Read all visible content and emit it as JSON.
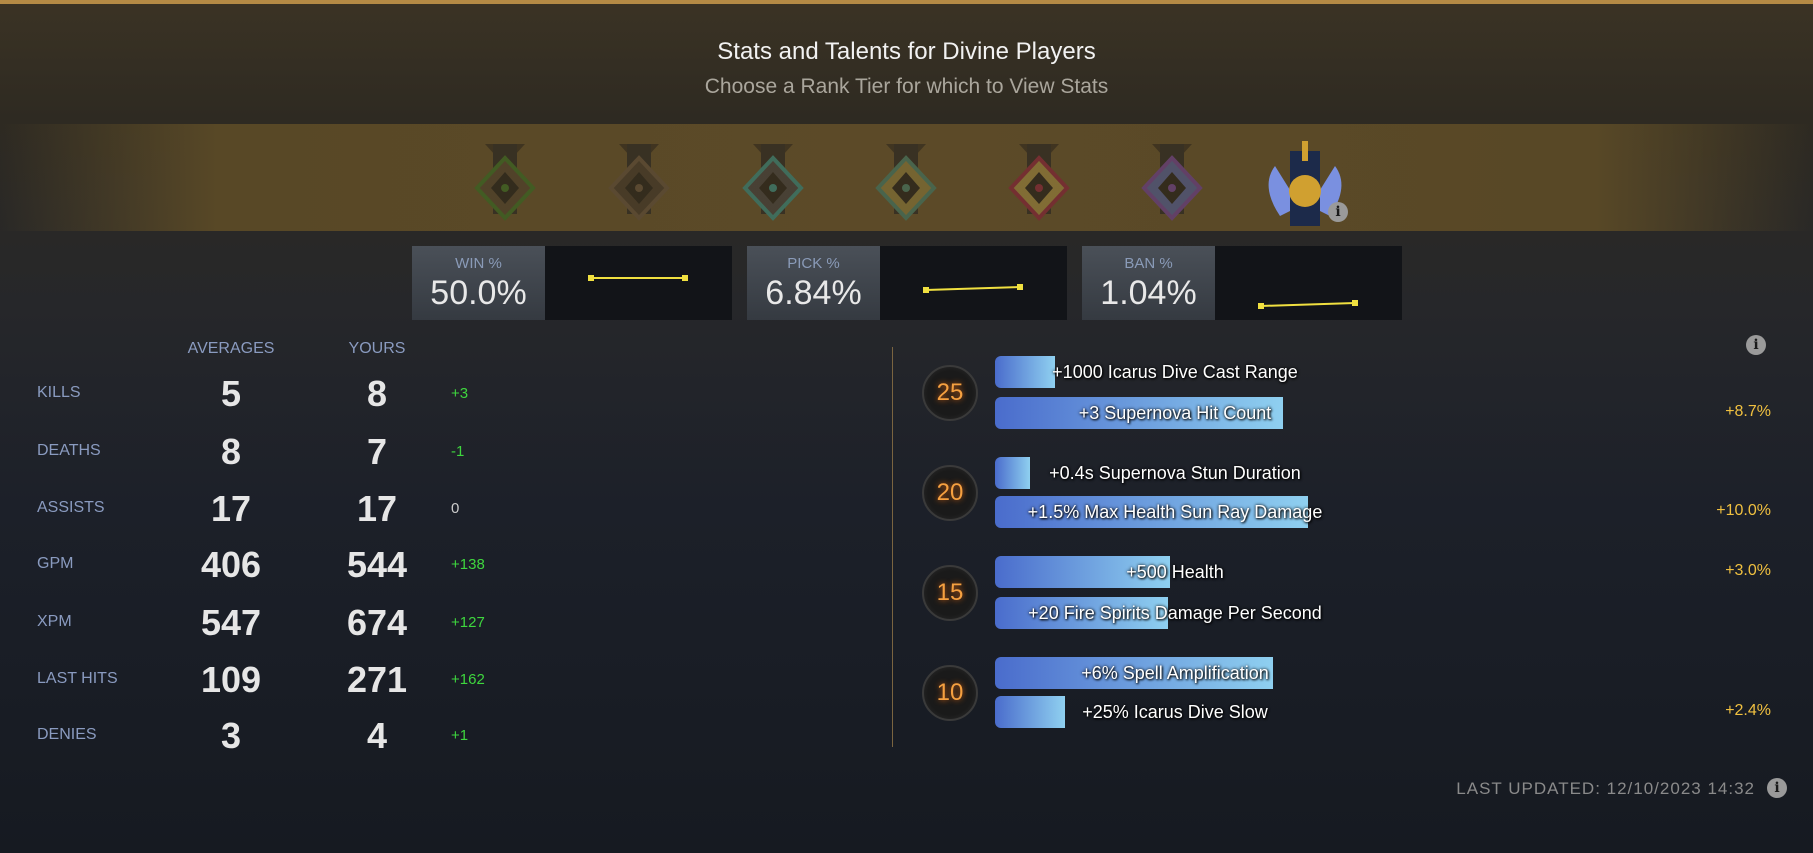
{
  "header": {
    "title": "Stats and Talents for Divine Players",
    "subtitle": "Choose a Rank Tier for which to View Stats"
  },
  "rank_tiers": [
    {
      "name": "Herald",
      "icon": "herald-medal-icon",
      "selected": false
    },
    {
      "name": "Guardian",
      "icon": "guardian-medal-icon",
      "selected": false
    },
    {
      "name": "Crusader",
      "icon": "crusader-medal-icon",
      "selected": false
    },
    {
      "name": "Archon",
      "icon": "archon-medal-icon",
      "selected": false
    },
    {
      "name": "Legend",
      "icon": "legend-medal-icon",
      "selected": false
    },
    {
      "name": "Ancient",
      "icon": "ancient-medal-icon",
      "selected": false
    },
    {
      "name": "Divine",
      "icon": "divine-medal-icon",
      "selected": true
    }
  ],
  "stats": [
    {
      "label": "WIN %",
      "value": "50.0%",
      "trend": [
        50.0,
        50.0
      ]
    },
    {
      "label": "PICK %",
      "value": "6.84%",
      "trend": [
        6.7,
        6.84
      ]
    },
    {
      "label": "BAN %",
      "value": "1.04%",
      "trend": [
        1.0,
        1.04
      ]
    }
  ],
  "table": {
    "headers": {
      "averages": "AVERAGES",
      "yours": "YOURS"
    },
    "rows": [
      {
        "label": "KILLS",
        "avg": "5",
        "yours": "8",
        "diff": "+3"
      },
      {
        "label": "DEATHS",
        "avg": "8",
        "yours": "7",
        "diff": "-1"
      },
      {
        "label": "ASSISTS",
        "avg": "17",
        "yours": "17",
        "diff": "0"
      },
      {
        "label": "GPM",
        "avg": "406",
        "yours": "544",
        "diff": "+138"
      },
      {
        "label": "XPM",
        "avg": "547",
        "yours": "674",
        "diff": "+127"
      },
      {
        "label": "LAST HITS",
        "avg": "109",
        "yours": "271",
        "diff": "+162"
      },
      {
        "label": "DENIES",
        "avg": "3",
        "yours": "4",
        "diff": "+1"
      }
    ]
  },
  "talents": [
    {
      "level": "25",
      "options": [
        {
          "name": "+1000 Icarus Dive Cast Range",
          "pick_fraction": 0.173,
          "win_diff": ""
        },
        {
          "name": "+3 Supernova Hit Count",
          "pick_fraction": 0.827,
          "win_diff": "+8.7%"
        }
      ]
    },
    {
      "level": "20",
      "options": [
        {
          "name": "+0.4s Supernova Stun Duration",
          "pick_fraction": 0.1,
          "win_diff": ""
        },
        {
          "name": "+1.5% Max Health Sun Ray Damage",
          "pick_fraction": 0.9,
          "win_diff": "+10.0%"
        }
      ]
    },
    {
      "level": "15",
      "options": [
        {
          "name": "+500 Health",
          "pick_fraction": 0.502,
          "win_diff": "+3.0%"
        },
        {
          "name": "+20 Fire Spirits Damage Per Second",
          "pick_fraction": 0.498,
          "win_diff": ""
        }
      ]
    },
    {
      "level": "10",
      "options": [
        {
          "name": "+6% Spell Amplification",
          "pick_fraction": 0.798,
          "win_diff": ""
        },
        {
          "name": "+25% Icarus Dive Slow",
          "pick_fraction": 0.202,
          "win_diff": "+2.4%"
        }
      ]
    }
  ],
  "footer": {
    "last_updated": "LAST UPDATED: 12/10/2023 14:32"
  },
  "colors": {
    "accent": "#b58a45",
    "positive": "#3ed63e",
    "neutral": "#cccccc",
    "win_diff": "#f0c040",
    "bar_start": "#4a6ccc",
    "bar_end": "#8fd0f0",
    "spark": "#f0e040"
  }
}
